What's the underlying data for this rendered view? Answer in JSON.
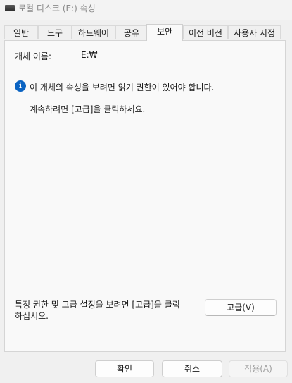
{
  "window": {
    "title": "로컬 디스크 (E:) 속성",
    "icon": "drive-icon"
  },
  "tabs": [
    {
      "label": "일반",
      "active": false
    },
    {
      "label": "도구",
      "active": false
    },
    {
      "label": "하드웨어",
      "active": false
    },
    {
      "label": "공유",
      "active": false
    },
    {
      "label": "보안",
      "active": true
    },
    {
      "label": "이전 버전",
      "active": false
    },
    {
      "label": "사용자 지정",
      "active": false
    }
  ],
  "security": {
    "object_name_label": "개체 이름:",
    "object_name_value": "E:₩",
    "info_icon": "info-icon",
    "info_message": "이 개체의 속성을 보려면 읽기 권한이 있어야 합니다.",
    "continue_message": "계속하려면 [고급]을 클릭하세요.",
    "advanced_hint_line1": "특정 권한 및 고급 설정을 보려면 [고급]을 클릭",
    "advanced_hint_line2": "하십시오.",
    "advanced_button": "고급(V)"
  },
  "footer": {
    "ok_button": "확인",
    "cancel_button": "취소",
    "apply_button": "적용(A)",
    "apply_enabled": false
  },
  "colors": {
    "info_blue": "#0a63c2"
  }
}
